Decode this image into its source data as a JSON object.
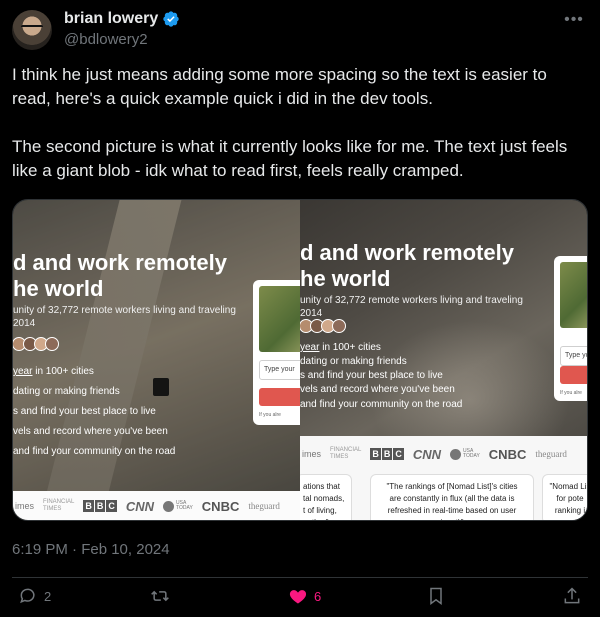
{
  "author": {
    "display_name": "brian lowery",
    "handle": "@bdlowery2",
    "verified_icon": "verified-badge-icon",
    "verified_color": "#1d9bf0"
  },
  "tweet": {
    "paragraph_1": "I think he just means adding some more spacing so the text is easier to read, here's a quick example quick i did in the dev tools.",
    "paragraph_2": "The second picture is what it currently looks like for me. The text just feels like a giant blob - idk what to read first, feels really cramped.",
    "timestamp": "6:19 PM · Feb 10, 2024"
  },
  "media": {
    "left": {
      "title_line_1": "d and work remotely",
      "title_line_2": "he world",
      "sub_line_1": "unity of 32,772 remote workers living and traveling",
      "sub_line_2": "2014",
      "features": [
        {
          "prefix": "",
          "underlined": "year",
          "rest": " in 100+ cities"
        },
        {
          "prefix": "",
          "underlined": "",
          "rest": "dating or making friends"
        },
        {
          "prefix": "",
          "underlined": "",
          "rest": "s and find your best place to live"
        },
        {
          "prefix": "",
          "underlined": "",
          "rest": "vels and record where you've been"
        },
        {
          "prefix": "",
          "underlined": "",
          "rest": "and find your community on the road"
        }
      ],
      "card_input": "Type your",
      "card_note": "If you alre",
      "press": {
        "mes": "imes",
        "ft_1": "FINANCIAL",
        "ft_2": "TIMES",
        "bbc": [
          "B",
          "B",
          "C"
        ],
        "cnn": "CNN",
        "usa_1": "USA",
        "usa_2": "TODAY",
        "cnbc": "CNBC",
        "guardian": "theguard"
      }
    },
    "right": {
      "title_line_1": "d and work remotely",
      "title_line_2": "he world",
      "sub_line_1": "unity of 32,772 remote workers living and traveling",
      "sub_line_2": "2014",
      "features": [
        {
          "underlined": "year",
          "rest": " in 100+ cities"
        },
        {
          "underlined": "",
          "rest": "dating or making friends"
        },
        {
          "underlined": "",
          "rest": "s and find your best place to live"
        },
        {
          "underlined": "",
          "rest": "vels and record where you've been"
        },
        {
          "underlined": "",
          "rest": "and find your community on the road"
        }
      ],
      "card_input": "Type you",
      "card_note": "If you alre",
      "press": {
        "mes": "imes",
        "ft_1": "FINANCIAL",
        "ft_2": "TIMES",
        "bbc": [
          "B",
          "B",
          "C"
        ],
        "cnn": "CNN",
        "usa_1": "USA",
        "usa_2": "TODAY",
        "cnbc": "CNBC",
        "guardian": "theguard"
      },
      "quotes": [
        "ations that\ntal nomads,\nt of living,\neather\"",
        "\"The rankings of [Nomad List]'s cities\nare constantly in flux (all the data is\nrefreshed in real-time based on user\ninput)\"",
        "\"Nomad Lis\nfor pote\nranking i"
      ]
    }
  },
  "actions": {
    "reply_count": "2",
    "repost_count": "",
    "like_count": "6",
    "like_color": "#f91880"
  }
}
